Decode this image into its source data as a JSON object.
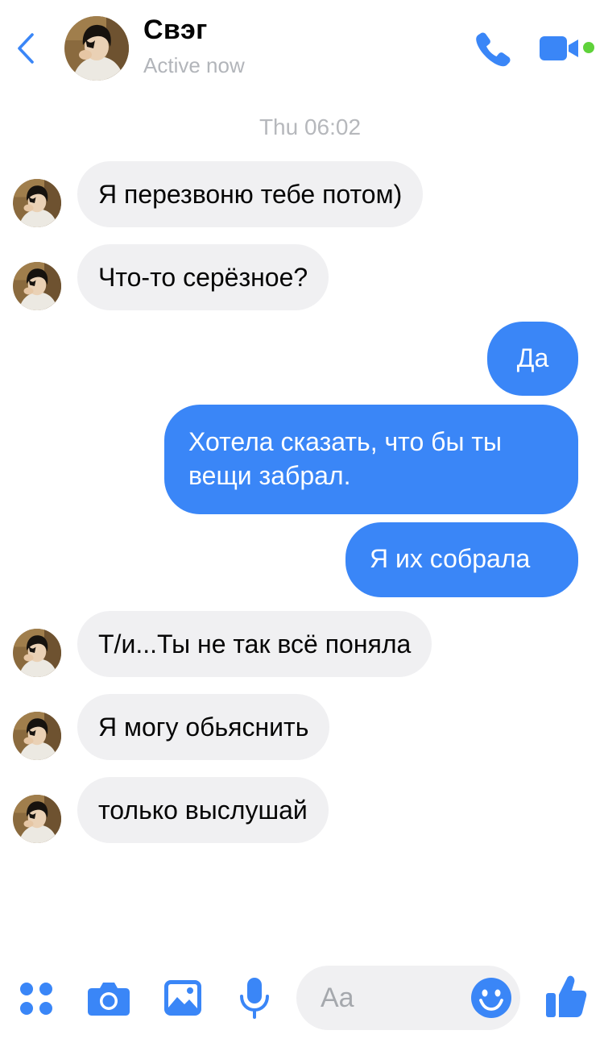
{
  "header": {
    "contact_name": "Свэг",
    "status": "Active now"
  },
  "thread": {
    "timestamp": "Thu 06:02",
    "messages": [
      {
        "direction": "in",
        "text": "Я перезвоню тебе потом)"
      },
      {
        "direction": "in",
        "text": "Что-то серёзное?"
      },
      {
        "direction": "out",
        "text": "Да"
      },
      {
        "direction": "out",
        "text": "Хотела сказать, что бы ты вещи забрал."
      },
      {
        "direction": "out",
        "text": "Я их собрала"
      },
      {
        "direction": "in",
        "text": "Т/и...Ты не так всё поняла"
      },
      {
        "direction": "in",
        "text": "Я могу обьяснить"
      },
      {
        "direction": "in",
        "text": "только выслушай"
      }
    ]
  },
  "composer": {
    "placeholder": "Aa"
  },
  "icons": {
    "back": "chevron-left-icon",
    "call": "phone-icon",
    "video": "video-camera-icon",
    "menu": "four-dots-icon",
    "camera": "camera-icon",
    "gallery": "image-icon",
    "voice": "microphone-icon",
    "emoji": "smiley-icon",
    "like": "thumbs-up-icon"
  },
  "colors": {
    "accent": "#3a86f7",
    "incoming_bubble": "#f0f0f2",
    "outgoing_text": "#ffffff",
    "status_text": "#b2b5ba",
    "active_dot": "#5fd23a"
  }
}
